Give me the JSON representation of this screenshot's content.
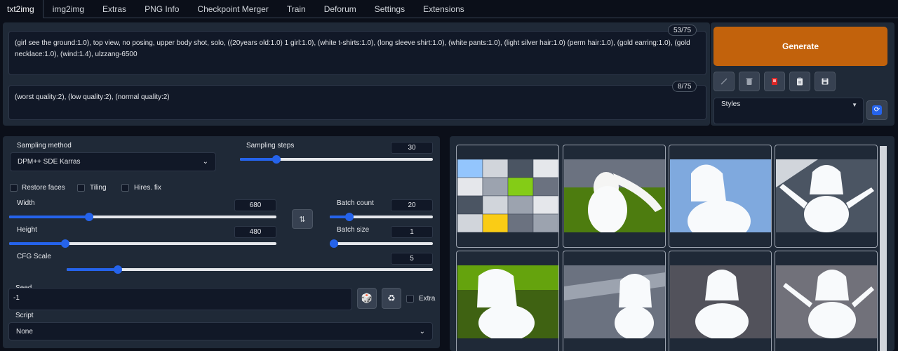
{
  "tabs": [
    "txt2img",
    "img2img",
    "Extras",
    "PNG Info",
    "Checkpoint Merger",
    "Train",
    "Deforum",
    "Settings",
    "Extensions"
  ],
  "prompt": {
    "positive": "(girl see the  ground:1.0), top view, no posing, upper body shot, solo, ((20years old:1.0) 1 girl:1.0), (white t-shirts:1.0), (long sleeve shirt:1.0), (white pants:1.0), (light silver hair:1.0) (perm hair:1.0), (gold earring:1.0), (gold necklace:1.0), (wind:1.4),  ulzzang-6500",
    "positive_tokens": "53/75",
    "negative": "(worst quality:2), (low quality:2), (normal quality:2)",
    "negative_tokens": "8/75"
  },
  "actions": {
    "generate_label": "Generate",
    "styles_label": "Styles",
    "tool_icons": [
      "pencil-icon",
      "trash-icon",
      "red-card-icon",
      "clipboard-icon",
      "save-icon"
    ]
  },
  "settings": {
    "sampling_method_label": "Sampling method",
    "sampling_method_value": "DPM++ SDE Karras",
    "sampling_steps_label": "Sampling steps",
    "sampling_steps_value": "30",
    "sampling_steps_fraction": 0.19,
    "restore_faces_label": "Restore faces",
    "tiling_label": "Tiling",
    "hires_fix_label": "Hires. fix",
    "width_label": "Width",
    "width_value": "680",
    "width_fraction": 0.3,
    "height_label": "Height",
    "height_value": "480",
    "height_fraction": 0.21,
    "batch_count_label": "Batch count",
    "batch_count_value": "20",
    "batch_count_fraction": 0.19,
    "batch_size_label": "Batch size",
    "batch_size_value": "1",
    "batch_size_fraction": 0.0,
    "cfg_scale_label": "CFG Scale",
    "cfg_scale_value": "5",
    "cfg_scale_fraction": 0.14,
    "seed_label": "Seed",
    "seed_value": "-1",
    "extra_label": "Extra",
    "script_label": "Script",
    "script_value": "None"
  },
  "gallery": {
    "image_count_visible": 8
  }
}
